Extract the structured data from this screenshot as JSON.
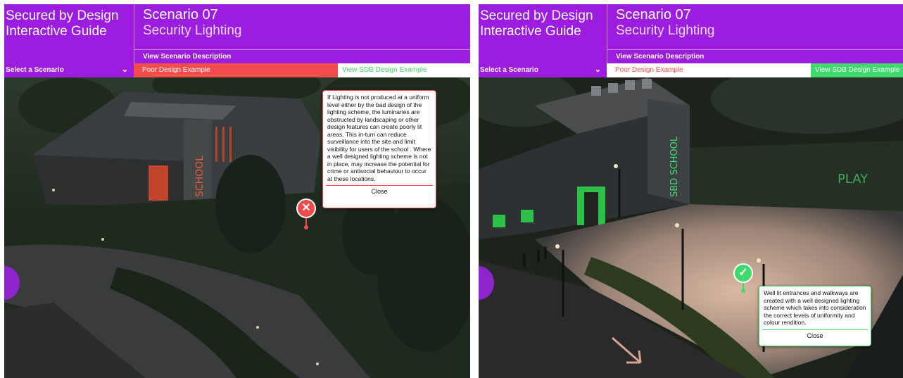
{
  "panels": [
    {
      "brand": {
        "line1": "Secured by Design",
        "line2": "Interactive Guide"
      },
      "scenario": {
        "number": "Scenario 07",
        "title": "Security Lighting"
      },
      "view_description": "View Scenario Description",
      "select_label": "Select a Scenario",
      "tabs": {
        "poor": "Poor Design Example",
        "sdb": "View SDB Design Example"
      },
      "active_tab": "poor",
      "info": {
        "text": "If Lighting is not produced at a uniform level either by the bad design of the lighting scheme, the luminaries are obstructed by landscaping or other design features can create poorly lit areas. This in-turn can reduce surveillance into the site and limit visibility for users of the school . Where a well designed lighting scheme is not in place, may increase the potential for crime or antisocial behaviour to occur at these locations.",
        "close": "Close"
      },
      "scene_labels": {
        "school": "SCHOOL"
      }
    },
    {
      "brand": {
        "line1": "Secured by Design",
        "line2": "Interactive Guide"
      },
      "scenario": {
        "number": "Scenario 07",
        "title": "Security Lighting"
      },
      "view_description": "View Scenario Description",
      "select_label": "Select a Scenario",
      "tabs": {
        "poor": "Poor Design Example",
        "sdb": "View SDB Design Example"
      },
      "active_tab": "sdb",
      "info": {
        "text": "Well lit entrances and walkways are created with a well designed lighting scheme which takes into consideration the correct levels of uniformity and colour rendition.",
        "close": "Close"
      },
      "scene_labels": {
        "school": "SBD SCHOOL",
        "play": "PLAY"
      }
    }
  ],
  "colors": {
    "purple": "#9c1ce0",
    "poor_red": "#f24c4c",
    "sdb_green": "#3fd96e"
  }
}
